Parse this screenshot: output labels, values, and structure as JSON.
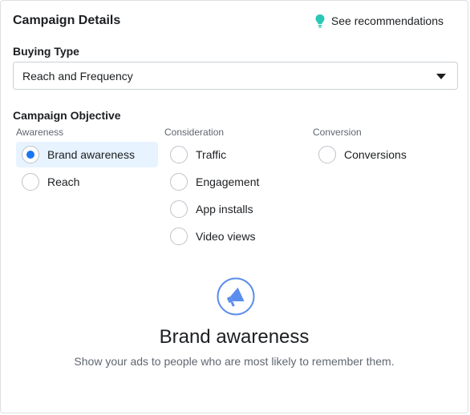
{
  "header": {
    "title": "Campaign Details",
    "recommendations_label": "See recommendations"
  },
  "buying_type": {
    "label": "Buying Type",
    "selected": "Reach and Frequency"
  },
  "objective": {
    "label": "Campaign Objective",
    "columns": [
      {
        "title": "Awareness",
        "options": [
          {
            "label": "Brand awareness",
            "checked": true
          },
          {
            "label": "Reach",
            "checked": false
          }
        ]
      },
      {
        "title": "Consideration",
        "options": [
          {
            "label": "Traffic",
            "checked": false
          },
          {
            "label": "Engagement",
            "checked": false
          },
          {
            "label": "App installs",
            "checked": false
          },
          {
            "label": "Video views",
            "checked": false
          }
        ]
      },
      {
        "title": "Conversion",
        "options": [
          {
            "label": "Conversions",
            "checked": false
          }
        ]
      }
    ]
  },
  "summary": {
    "icon": "megaphone-icon",
    "title": "Brand awareness",
    "description": "Show your ads to people who are most likely to remember them."
  },
  "colors": {
    "accent": "#1877f2",
    "selected_bg": "#e7f3ff",
    "bulb": "#2bc7b6",
    "illustration": "#5b8def"
  }
}
